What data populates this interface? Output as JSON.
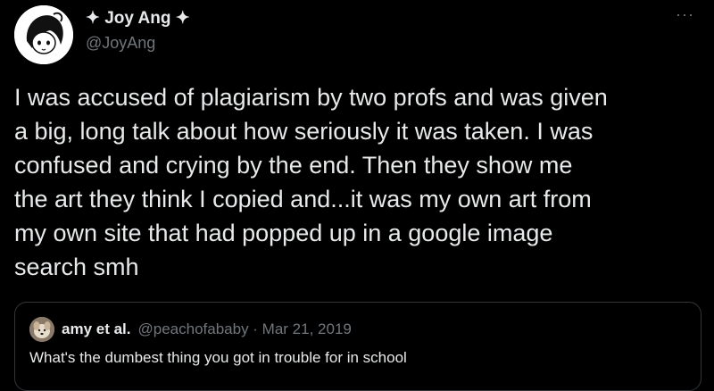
{
  "tweet": {
    "author": {
      "display_name": "✦ Joy Ang ✦",
      "handle": "@JoyAng"
    },
    "more_icon": "···",
    "text_lines": [
      "I was accused of plagiarism by two profs and was given",
      "a big, long talk about how seriously it was taken. I was",
      "confused and crying by the end. Then they show me",
      "the art they think I copied and...it was my own art from",
      "my own site that had popped up in a google image",
      "search smh"
    ],
    "quote": {
      "display_name": "amy et al.",
      "meta": "@peachofababy · Mar 21, 2019",
      "text": "What's the dumbest thing you got in trouble for in school"
    }
  },
  "colors": {
    "background": "#000000",
    "primary_text": "#e7e9ea",
    "secondary_text": "#71767b",
    "border": "#333639"
  }
}
